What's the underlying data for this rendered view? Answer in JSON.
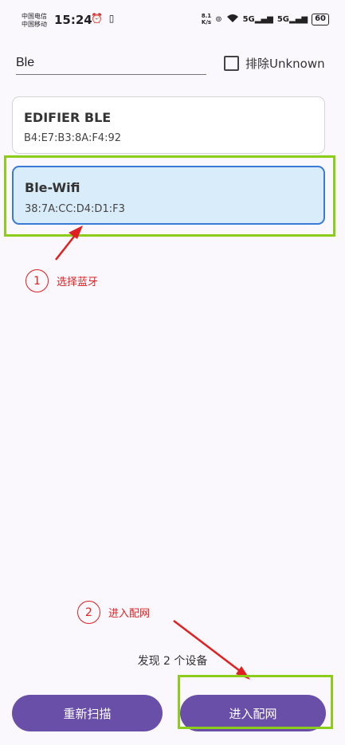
{
  "status_bar": {
    "carrier_1": "中国电信",
    "carrier_2": "中国移动",
    "time": "15:24",
    "left_icons": "⏰ ▯",
    "speed_top": "8.1",
    "speed_bottom": "K/s",
    "net_1": "5G",
    "net_2": "5G",
    "battery": "60"
  },
  "search": {
    "value": "Ble",
    "exclude_label": "排除Unknown"
  },
  "devices": [
    {
      "name": "EDIFIER BLE",
      "mac": "B4:E7:B3:8A:F4:92"
    },
    {
      "name": "Ble-Wifi",
      "mac": "38:7A:CC:D4:D1:F3"
    }
  ],
  "annotations": {
    "step_1_number": "1",
    "step_1_text": "选择蓝牙",
    "step_2_number": "2",
    "step_2_text": "进入配网"
  },
  "footer": {
    "found_text": "发现 2 个设备",
    "rescan_label": "重新扫描",
    "enter_label": "进入配网"
  },
  "colors": {
    "accent": "#6a4fa8",
    "selected_bg": "#d8ecfa",
    "selected_border": "#3a7bd5",
    "highlight": "#8ccc1a",
    "annotation": "#e02020"
  }
}
